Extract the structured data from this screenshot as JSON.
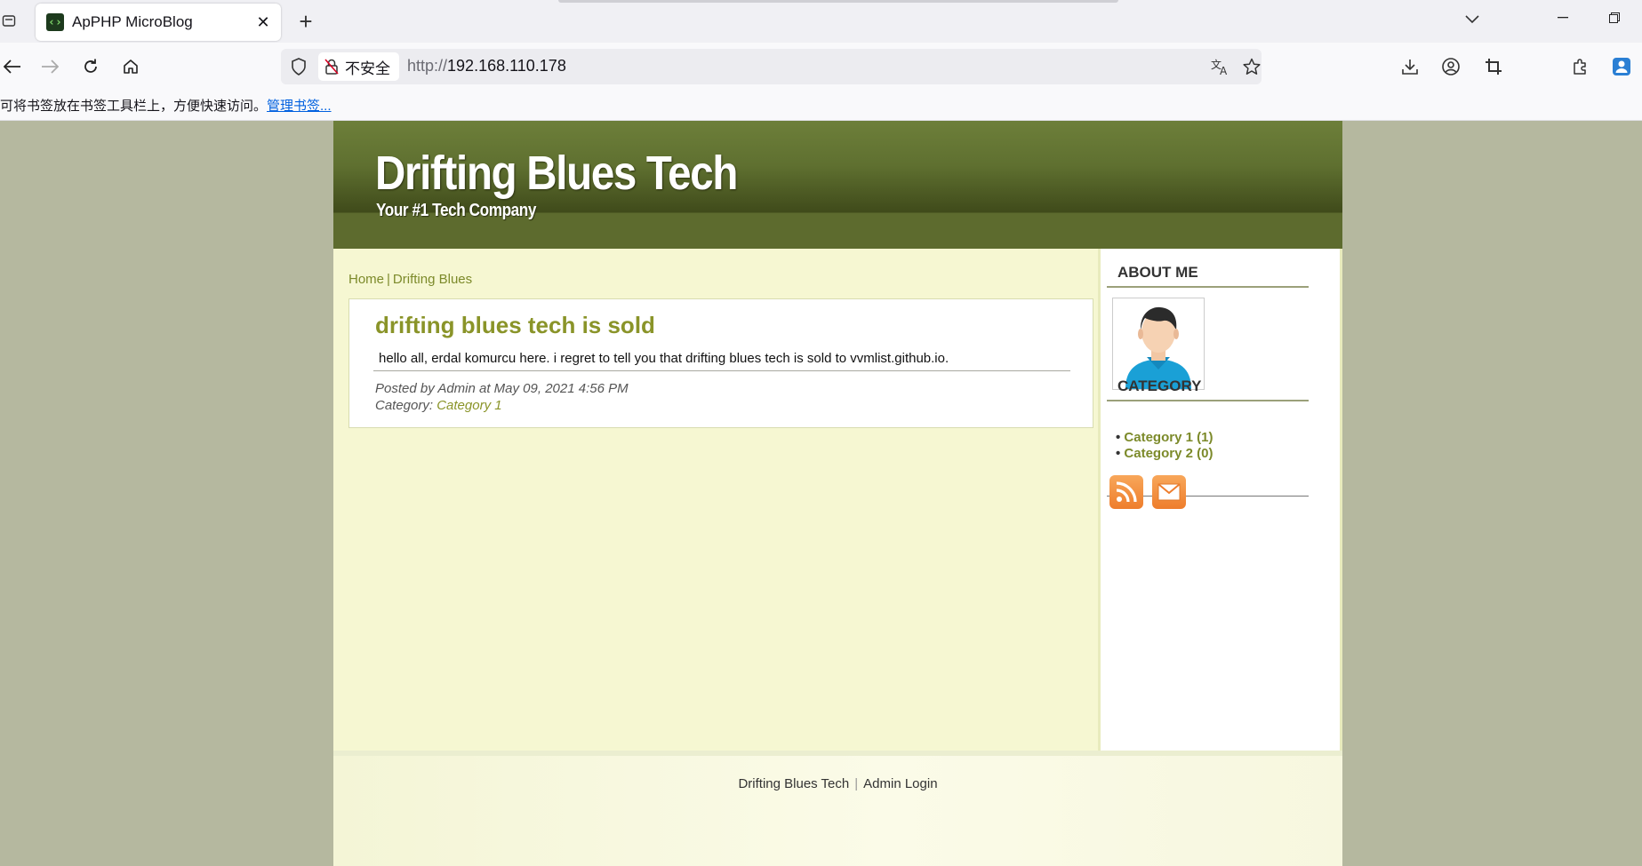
{
  "browser": {
    "tab_title": "ApPHP MicroBlog",
    "tab_close": "✕",
    "new_tab": "+",
    "security_label": "不安全",
    "url_protocol": "http://",
    "url_host": "192.168.110.178",
    "bookmark_hint": "可将书签放在书签工具栏上，方便快速访问。",
    "bookmark_manage_link": "管理书签..."
  },
  "site": {
    "title": "Drifting Blues Tech",
    "tagline": "Your #1 Tech Company"
  },
  "breadcrumb": {
    "home": "Home",
    "separator": "|",
    "current": "Drifting Blues"
  },
  "post": {
    "title": "drifting blues tech is sold",
    "body": "hello all, erdal komurcu here. i regret to tell you that drifting blues tech is sold to vvmlist.github.io.",
    "posted_by": "Posted by Admin at May 09, 2021 4:56 PM",
    "category_label": "Category: ",
    "category_link": "Category 1"
  },
  "sidebar": {
    "about_heading": "ABOUT ME",
    "category_heading": "CATEGORY",
    "categories": [
      {
        "bullet": "• ",
        "label": "Category 1 (1)"
      },
      {
        "bullet": "• ",
        "label": "Category 2 (0)"
      }
    ]
  },
  "footer": {
    "site_link": "Drifting Blues Tech",
    "separator": "|",
    "admin_link": "Admin Login"
  },
  "colors": {
    "page_bg": "#b5b89f",
    "header_green": "#5f7030",
    "content_bg": "#f6f7d2",
    "link_olive": "#7c8a2a",
    "post_title": "#8a9429",
    "feed_orange": "#f08a3a"
  }
}
